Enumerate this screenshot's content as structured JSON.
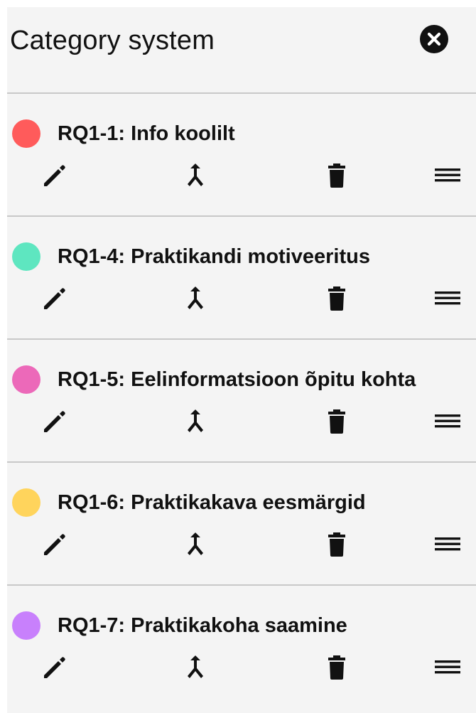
{
  "panel": {
    "title": "Category system",
    "close_icon": "close-circle-icon"
  },
  "categories": [
    {
      "label": "RQ1-1: Info koolilt",
      "color": "#ff5b5b"
    },
    {
      "label": "RQ1-4: Praktikandi motiveeritus",
      "color": "#5ee6c0"
    },
    {
      "label": "RQ1-5: Eelinformatsioon õpitu kohta",
      "color": "#ec69b9"
    },
    {
      "label": "RQ1-6: Praktikakava eesmärgid",
      "color": "#ffd45c"
    },
    {
      "label": "RQ1-7: Praktikakoha saamine",
      "color": "#c880fc"
    }
  ],
  "action_icons": [
    "pencil-icon",
    "merge-icon",
    "trash-icon",
    "drag-handle-icon"
  ]
}
